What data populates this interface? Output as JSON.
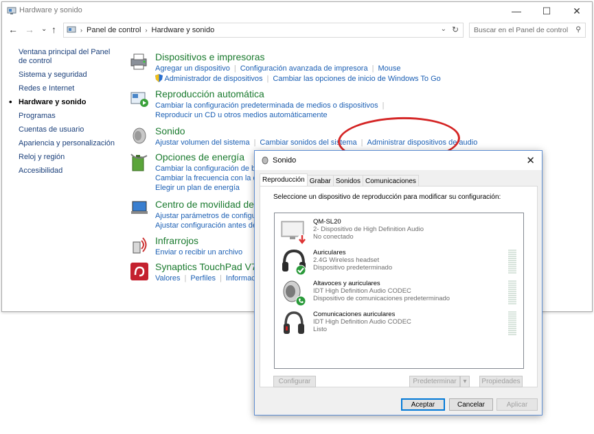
{
  "window": {
    "title": "Hardware y sonido",
    "minimize": "—",
    "maximize": "☐",
    "close": "✕"
  },
  "address": {
    "back": "←",
    "forward": "→",
    "dropdown": "⌄",
    "up": "↑",
    "crumb1": "Panel de control",
    "crumb2": "Hardware y sonido",
    "sep": "›",
    "search_placeholder": "Buscar en el Panel de control"
  },
  "leftnav": [
    "Ventana principal del Panel de control",
    "Sistema y seguridad",
    "Redes e Internet",
    "Hardware y sonido",
    "Programas",
    "Cuentas de usuario",
    "Apariencia y personalización",
    "Reloj y región",
    "Accesibilidad"
  ],
  "categories": {
    "devices": {
      "title": "Dispositivos e impresoras",
      "line1": [
        "Agregar un dispositivo",
        "Configuración avanzada de impresora",
        "Mouse"
      ],
      "line2": [
        "Administrador de dispositivos",
        "Cambiar las opciones de inicio de Windows To Go"
      ]
    },
    "autoplay": {
      "title": "Reproducción automática",
      "line1": [
        "Cambiar la configuración predeterminada de medios o dispositivos"
      ],
      "line2": [
        "Reproducir un CD u otros medios automáticamente"
      ]
    },
    "sound": {
      "title": "Sonido",
      "line1": [
        "Ajustar volumen del sistema",
        "Cambiar sonidos del sistema",
        "Administrar dispositivos de audio"
      ]
    },
    "power": {
      "title": "Opciones de energía",
      "line1": [
        "Cambiar la configuración de bate"
      ],
      "line2": [
        "Cambiar la frecuencia con la que"
      ],
      "line3": [
        "Elegir un plan de energía"
      ]
    },
    "mobility": {
      "title": "Centro de movilidad de W",
      "line1": [
        "Ajustar parámetros de configurac"
      ],
      "line2": [
        "Ajustar configuración antes de re"
      ]
    },
    "infrared": {
      "title": "Infrarrojos",
      "line1": [
        "Enviar o recibir un archivo"
      ]
    },
    "touchpad": {
      "title": "Synaptics TouchPad V7.5",
      "line1": [
        "Valores",
        "Perfiles",
        "Informacio"
      ]
    }
  },
  "dialog": {
    "title": "Sonido",
    "close": "✕",
    "tabs": [
      "Reproducción",
      "Grabar",
      "Sonidos",
      "Comunicaciones"
    ],
    "instruction": "Seleccione un dispositivo de reproducción para modificar su configuración:",
    "devices": [
      {
        "name": "QM-SL20",
        "line2": "2- Dispositivo de High Definition Audio",
        "line3": "No conectado",
        "icon": "monitor-speaker-icon",
        "badge": "red-down-arrow"
      },
      {
        "name": "Auriculares",
        "line2": "2.4G Wireless headset",
        "line3": "Dispositivo predeterminado",
        "icon": "headphones-icon",
        "badge": "green-check"
      },
      {
        "name": "Altavoces y auriculares",
        "line2": "IDT High Definition Audio CODEC",
        "line3": "Dispositivo de comunicaciones predeterminado",
        "icon": "speaker-icon",
        "badge": "green-phone"
      },
      {
        "name": "Comunicaciones auriculares",
        "line2": "IDT High Definition Audio CODEC",
        "line3": "Listo",
        "icon": "headphones-icon",
        "badge": ""
      }
    ],
    "buttons": {
      "configure": "Configurar",
      "set_default": "Predeterminar",
      "properties": "Propiedades",
      "ok": "Aceptar",
      "cancel": "Cancelar",
      "apply": "Aplicar"
    }
  },
  "colors": {
    "category_title": "#1a7a2e",
    "link": "#1b5fb4",
    "highlight_ellipse": "#d42424"
  }
}
